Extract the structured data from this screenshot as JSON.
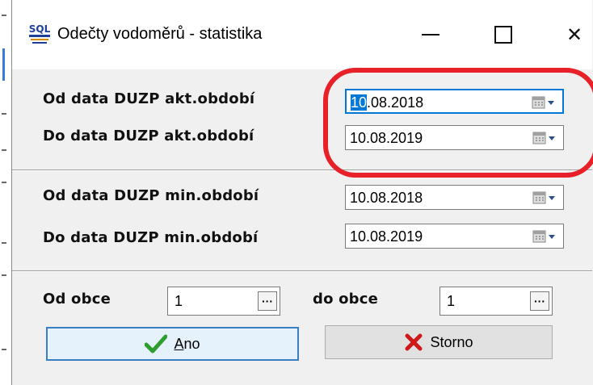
{
  "window": {
    "title": "Odečty vodoměrů - statistika",
    "icon": "sql-app-icon",
    "controls": {
      "minimize": "minimize-icon",
      "maximize": "maximize-icon",
      "close_glyph": "✕"
    }
  },
  "current_period": {
    "from_label": "Od data DUZP akt.období",
    "from_value_selected": "10",
    "from_value_rest": ".08.2018",
    "to_label": "Do data DUZP akt.období",
    "to_value": "10.08.2019"
  },
  "previous_period": {
    "from_label": "Od data DUZP min.období",
    "from_value": "10.08.2018",
    "to_label": "Do data DUZP min.období",
    "to_value": "10.08.2019"
  },
  "municipality": {
    "from_label": "Od obce",
    "from_value": "1",
    "to_label": "do obce",
    "to_value": "1",
    "browse_glyph": "···"
  },
  "buttons": {
    "ok_label_underlined": "A",
    "ok_label_rest": "no",
    "cancel_label": "Storno"
  },
  "colors": {
    "accent": "#0078d7",
    "annotation": "#e8202a",
    "check": "#2e9e2e",
    "cross": "#d01818"
  }
}
